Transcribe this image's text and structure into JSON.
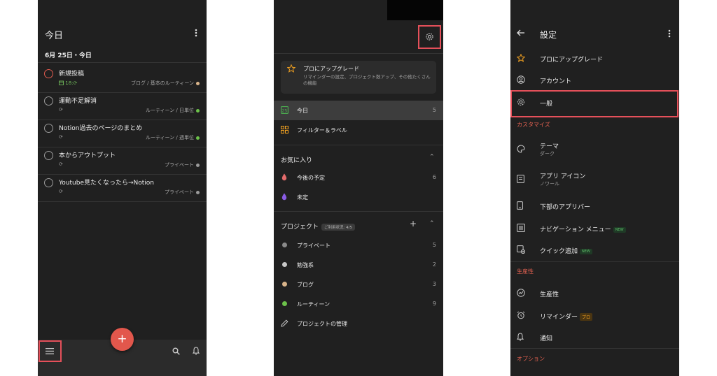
{
  "panel1": {
    "title": "今日",
    "date_header": "6月 25日・今日",
    "tasks": [
      {
        "title": "新規投稿",
        "time": "18:",
        "project": "ブログ / 基本のルーティーン",
        "dot_color": "#d9b48a"
      },
      {
        "title": "運動不足解消",
        "project": "ルーティーン / 日単位",
        "dot_color": "#6cc24a"
      },
      {
        "title": "Notion過去のページのまとめ",
        "project": "ルーティーン / 週単位",
        "dot_color": "#6cc24a"
      },
      {
        "title": "本からアウトプット",
        "project": "プライベート",
        "dot_color": "#9a9a9a"
      },
      {
        "title": "Youtube見たくなったら→Notion",
        "project": "プライベート",
        "dot_color": "#9a9a9a"
      }
    ],
    "fab_label": "+"
  },
  "panel2": {
    "upgrade_title": "プロにアップグレード",
    "upgrade_desc": "リマインダーの設定、プロジェクト数アップ、その他たくさんの機能",
    "today_label": "今日",
    "today_count": "5",
    "filters_label": "フィルター＆ラベル",
    "favorites_header": "お気に入り",
    "favorites": [
      {
        "label": "今後の予定",
        "count": "6",
        "color": "#e36b6b"
      },
      {
        "label": "未定",
        "count": "",
        "color": "#8a5ce6"
      }
    ],
    "projects_header": "プロジェクト",
    "usage_badge": "ご利用状況: 4/5",
    "projects": [
      {
        "label": "プライベート",
        "count": "5",
        "color": "#8a8a8a"
      },
      {
        "label": "勉強系",
        "count": "2",
        "color": "#c8c8c8"
      },
      {
        "label": "ブログ",
        "count": "3",
        "color": "#d9b48a"
      },
      {
        "label": "ルーティーン",
        "count": "9",
        "color": "#6cc24a"
      }
    ],
    "manage_projects": "プロジェクトの管理"
  },
  "panel3": {
    "title": "設定",
    "upgrade": "プロにアップグレード",
    "account": "アカウント",
    "general": "一般",
    "customize_header": "カスタマイズ",
    "theme": "テーマ",
    "theme_value": "ダーク",
    "app_icon": "アプリ アイコン",
    "app_icon_value": "ノワール",
    "bottom_bar": "下部のアプリバー",
    "nav_menu": "ナビゲーション メニュー",
    "quick_add": "クイック追加",
    "new_badge": "NEW",
    "productivity_header": "生産性",
    "productivity": "生産性",
    "reminders": "リマインダー",
    "pro_badge": "プロ",
    "notifications": "通知",
    "options_header": "オプション"
  },
  "colors": {
    "bg": "#202020",
    "accent_red": "#e5505a",
    "fab": "#e2574c",
    "green": "#6fb85a",
    "star": "#f0a020"
  }
}
